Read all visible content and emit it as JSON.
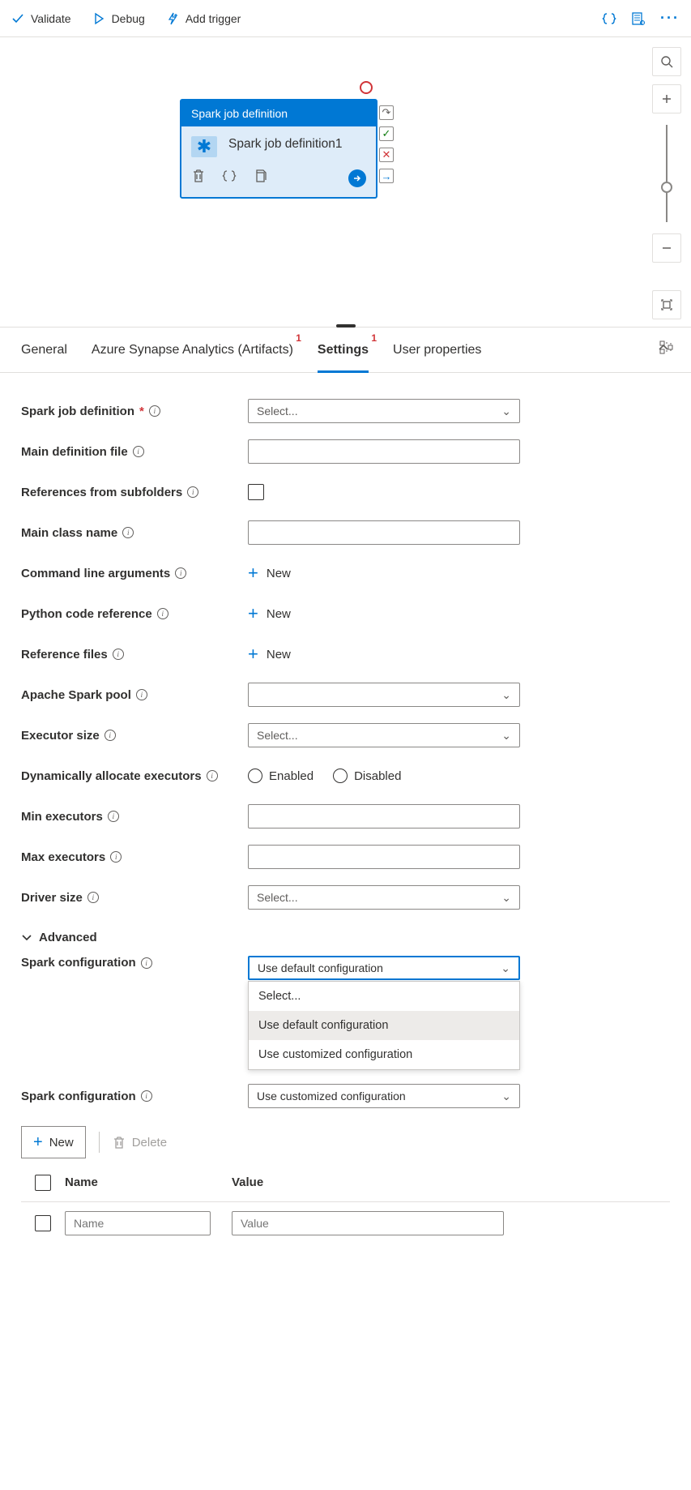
{
  "toolbar": {
    "validate": "Validate",
    "debug": "Debug",
    "add_trigger": "Add trigger"
  },
  "activity": {
    "header": "Spark job definition",
    "title": "Spark job definition1"
  },
  "tabs": {
    "general": "General",
    "artifacts": "Azure Synapse Analytics (Artifacts)",
    "artifacts_badge": "1",
    "settings": "Settings",
    "settings_badge": "1",
    "user_props": "User properties"
  },
  "form": {
    "spark_job_def_label": "Spark job definition",
    "select_placeholder": "Select...",
    "main_def_file": "Main definition file",
    "ref_subfolders": "References from subfolders",
    "main_class": "Main class name",
    "cmd_args": "Command line arguments",
    "new_label": "New",
    "py_ref": "Python code reference",
    "ref_files": "Reference files",
    "spark_pool": "Apache Spark pool",
    "executor_size": "Executor size",
    "dyn_alloc": "Dynamically allocate executors",
    "enabled": "Enabled",
    "disabled": "Disabled",
    "min_exec": "Min executors",
    "max_exec": "Max executors",
    "driver_size": "Driver size",
    "advanced": "Advanced",
    "spark_conf": "Spark configuration",
    "use_default": "Use default configuration",
    "use_custom": "Use customized configuration",
    "dropdown": {
      "opt_select": "Select...",
      "opt_default": "Use default configuration",
      "opt_custom": "Use customized configuration"
    },
    "new_btn": "New",
    "delete_btn": "Delete",
    "col_name": "Name",
    "col_value": "Value",
    "ph_name": "Name",
    "ph_value": "Value"
  }
}
